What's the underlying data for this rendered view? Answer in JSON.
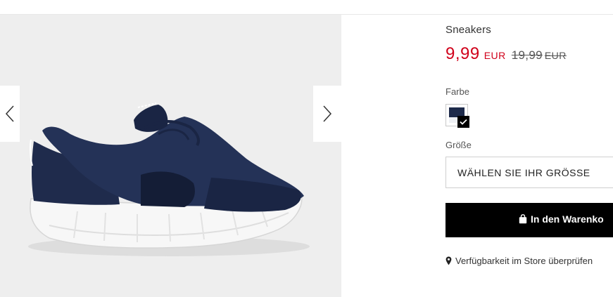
{
  "product": {
    "title": "Sneakers",
    "price": "9,99",
    "currency": "EUR",
    "old_price": "19,99",
    "old_currency": "EUR"
  },
  "color": {
    "label": "Farbe",
    "selected_swatch": "navy",
    "swatch_color": "#1d2a4a"
  },
  "size": {
    "label": "Größe",
    "placeholder": "WÄHLEN SIE IHR GRÖSSE"
  },
  "cart": {
    "label": "In den Warenko",
    "icon": "shopping-bag-icon"
  },
  "store": {
    "label": "Verfügbarkeit im Store überprüfen",
    "icon": "map-pin-icon"
  },
  "gallery": {
    "prev_icon": "chevron-left-icon",
    "next_icon": "chevron-right-icon",
    "image": "navy-sneaker-photo"
  },
  "colors": {
    "sale": "#d0021b",
    "button": "#000000",
    "shoe": "#1d2a4a"
  }
}
